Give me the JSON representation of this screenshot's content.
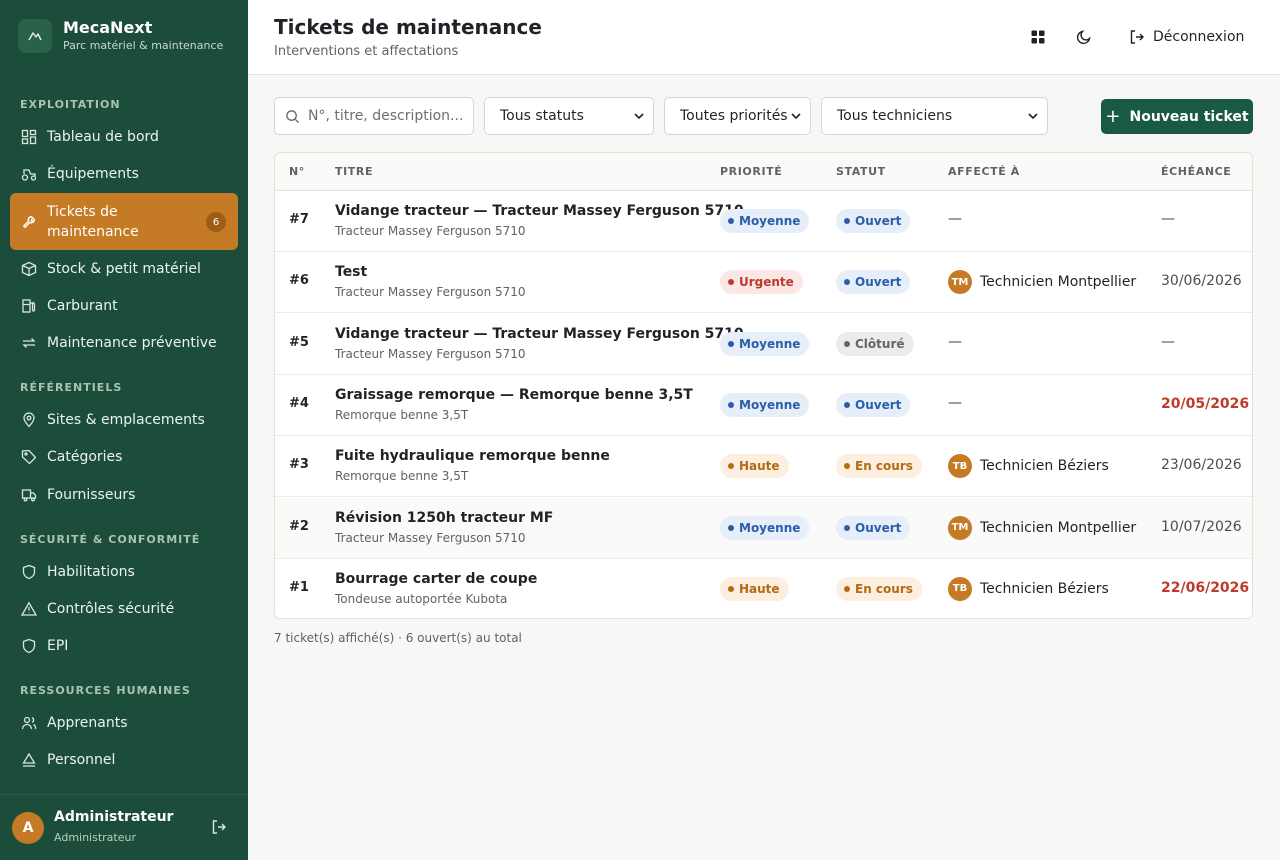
{
  "brand": {
    "name": "MecaNext",
    "subtitle": "Parc matériel & maintenance"
  },
  "sidebar": {
    "sections": [
      {
        "title": "EXPLOITATION"
      },
      {
        "title": "RÉFÉRENTIELS"
      },
      {
        "title": "SÉCURITÉ & CONFORMITÉ"
      },
      {
        "title": "RESSOURCES HUMAINES"
      }
    ],
    "items": [
      {
        "label": "Tableau de bord",
        "icon": "dashboard-icon"
      },
      {
        "label": "Équipements",
        "icon": "tractor-icon"
      },
      {
        "label": "Tickets de maintenance",
        "icon": "wrench-icon",
        "badge": "6",
        "active": true
      },
      {
        "label": "Stock & petit matériel",
        "icon": "box-icon"
      },
      {
        "label": "Carburant",
        "icon": "fuel-icon"
      },
      {
        "label": "Maintenance préventive",
        "icon": "cycle-icon"
      },
      {
        "label": "Sites & emplacements",
        "icon": "map-pin-icon"
      },
      {
        "label": "Catégories",
        "icon": "tag-icon"
      },
      {
        "label": "Fournisseurs",
        "icon": "truck-icon"
      },
      {
        "label": "Habilitations",
        "icon": "shield-icon"
      },
      {
        "label": "Contrôles sécurité",
        "icon": "warning-icon"
      },
      {
        "label": "EPI",
        "icon": "shield-icon"
      },
      {
        "label": "Apprenants",
        "icon": "users-icon"
      },
      {
        "label": "Personnel",
        "icon": "person-icon"
      }
    ]
  },
  "user": {
    "initial": "A",
    "name": "Administrateur",
    "role": "Administrateur"
  },
  "header": {
    "title": "Tickets de maintenance",
    "subtitle": "Interventions et affectations",
    "logout_label": "Déconnexion"
  },
  "filters": {
    "search_placeholder": "N°, titre, description...",
    "status": "Tous statuts",
    "priority": "Toutes priorités",
    "technician": "Tous techniciens",
    "new_ticket_label": "Nouveau ticket"
  },
  "table": {
    "columns": [
      "N°",
      "TITRE",
      "PRIORITÉ",
      "STATUT",
      "AFFECTÉ À",
      "ÉCHÉANCE"
    ],
    "rows": [
      {
        "num": "#7",
        "title": "Vidange tracteur — Tracteur Massey Ferguson 5710",
        "equipment": "Tracteur Massey Ferguson 5710",
        "priority": "Moyenne",
        "status": "Ouvert",
        "assignee": "—",
        "initials": "",
        "due": "—",
        "late": false
      },
      {
        "num": "#6",
        "title": "Test",
        "equipment": "Tracteur Massey Ferguson 5710",
        "priority": "Urgente",
        "status": "Ouvert",
        "assignee": "Technicien Montpellier",
        "initials": "TM",
        "due": "30/06/2026",
        "late": false
      },
      {
        "num": "#5",
        "title": "Vidange tracteur — Tracteur Massey Ferguson 5710",
        "equipment": "Tracteur Massey Ferguson 5710",
        "priority": "Moyenne",
        "status": "Clôturé",
        "assignee": "—",
        "initials": "",
        "due": "—",
        "late": false
      },
      {
        "num": "#4",
        "title": "Graissage remorque — Remorque benne 3,5T",
        "equipment": "Remorque benne 3,5T",
        "priority": "Moyenne",
        "status": "Ouvert",
        "assignee": "—",
        "initials": "",
        "due": "20/05/2026",
        "late": true
      },
      {
        "num": "#3",
        "title": "Fuite hydraulique remorque benne",
        "equipment": "Remorque benne 3,5T",
        "priority": "Haute",
        "status": "En cours",
        "assignee": "Technicien Béziers",
        "initials": "TB",
        "due": "23/06/2026",
        "late": false
      },
      {
        "num": "#2",
        "title": "Révision 1250h tracteur MF",
        "equipment": "Tracteur Massey Ferguson 5710",
        "priority": "Moyenne",
        "status": "Ouvert",
        "assignee": "Technicien Montpellier",
        "initials": "TM",
        "due": "10/07/2026",
        "late": false
      },
      {
        "num": "#1",
        "title": "Bourrage carter de coupe",
        "equipment": "Tondeuse autoportée Kubota",
        "priority": "Haute",
        "status": "En cours",
        "assignee": "Technicien Béziers",
        "initials": "TB",
        "due": "22/06/2026",
        "late": true
      }
    ]
  },
  "summary": "7 ticket(s) affiché(s) · 6 ouvert(s) au total",
  "colors": {
    "sidebar_bg": "#1b4d3a",
    "active_item": "#c57a25",
    "primary_button": "#1b5a42",
    "late_due": "#c0392b",
    "priority_moyenne": "#2b5ea8",
    "priority_urgente": "#c0392b",
    "priority_haute": "#b36a12",
    "status_ouvert": "#2b5ea8",
    "status_en_cours": "#b36a12",
    "status_cloture": "#666666"
  }
}
